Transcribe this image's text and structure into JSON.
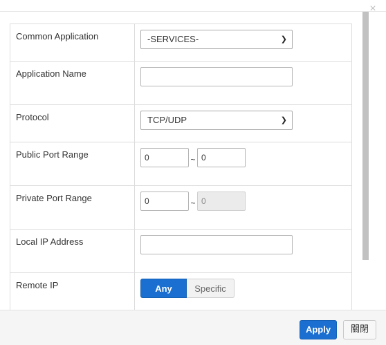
{
  "dialog": {
    "close_glyph": "×"
  },
  "rows": {
    "common_application": {
      "label": "Common Application",
      "value": "-SERVICES-"
    },
    "application_name": {
      "label": "Application Name",
      "value": ""
    },
    "protocol": {
      "label": "Protocol",
      "value": "TCP/UDP"
    },
    "public_port_range": {
      "label": "Public Port Range",
      "from": "0",
      "separator": "~",
      "to": "0"
    },
    "private_port_range": {
      "label": "Private Port Range",
      "from": "0",
      "separator": "~",
      "to": "0"
    },
    "local_ip": {
      "label": "Local IP Address",
      "value": ""
    },
    "remote_ip": {
      "label": "Remote IP",
      "option_any": "Any",
      "option_specific": "Specific",
      "selected": "Any"
    }
  },
  "footer": {
    "apply_label": "Apply",
    "close_label": "關閉"
  },
  "colors": {
    "accent": "#1a6fd0",
    "footer_bg": "#f5f5f5",
    "border": "#dcdcdc"
  },
  "icons": {
    "dropdown": "chevron-down-icon",
    "close": "close-icon"
  }
}
